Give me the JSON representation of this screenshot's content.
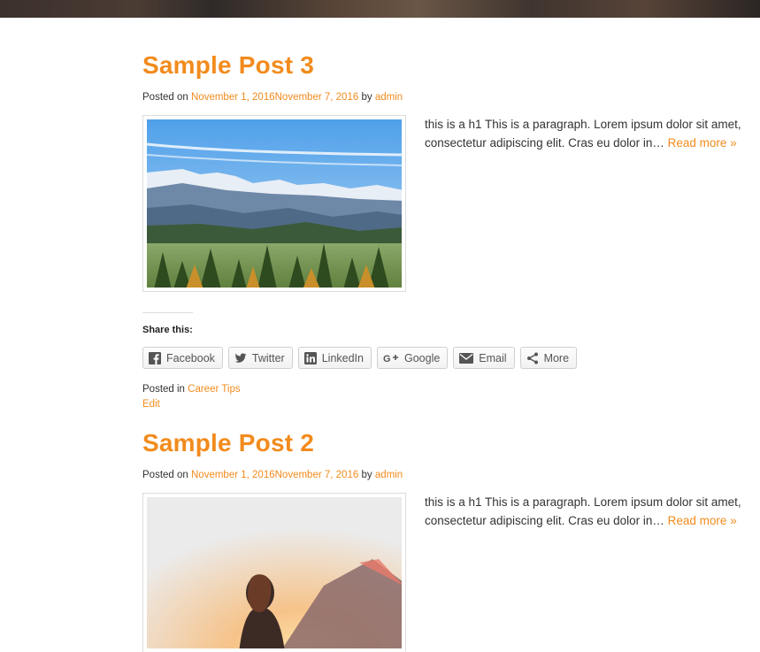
{
  "colors": {
    "accent": "#f28b1d",
    "text": "#333333"
  },
  "posts": [
    {
      "title": "Sample Post 3",
      "posted_on_label": "Posted on",
      "date_published": "November 1, 2016",
      "date_updated": "November 7, 2016",
      "by_label": "by",
      "author": "admin",
      "excerpt": "this is a h1 This is a paragraph. Lorem ipsum dolor sit amet, consectetur adipiscing elit. Cras eu dolor in…",
      "read_more": "Read more »",
      "share_title": "Share this:",
      "share_buttons": [
        {
          "label": "Facebook",
          "icon": "facebook-icon"
        },
        {
          "label": "Twitter",
          "icon": "twitter-icon"
        },
        {
          "label": "LinkedIn",
          "icon": "linkedin-icon"
        },
        {
          "label": "Google",
          "icon": "google-plus-icon"
        },
        {
          "label": "Email",
          "icon": "email-icon"
        },
        {
          "label": "More",
          "icon": "share-icon"
        }
      ],
      "posted_in_label": "Posted in",
      "category": "Career Tips",
      "edit": "Edit"
    },
    {
      "title": "Sample Post 2",
      "posted_on_label": "Posted on",
      "date_published": "November 1, 2016",
      "date_updated": "November 7, 2016",
      "by_label": "by",
      "author": "admin",
      "excerpt": "this is a h1 This is a paragraph. Lorem ipsum dolor sit amet, consectetur adipiscing elit. Cras eu dolor in…",
      "read_more": "Read more »"
    }
  ]
}
